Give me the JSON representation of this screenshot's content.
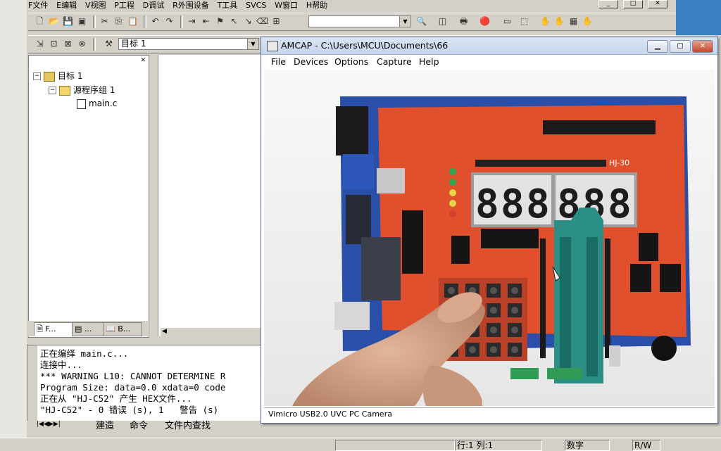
{
  "keil": {
    "menu": [
      "F文件",
      "E编辑",
      "V视图",
      "P工程",
      "D调试",
      "R外围设备",
      "T工具",
      "SVCS",
      "W窗口",
      "H帮助"
    ],
    "target_combo": "目标 1",
    "project": {
      "root": "目标 1",
      "group": "源程序组 1",
      "file": "main.c"
    },
    "project_tabs": [
      "F...",
      "...",
      "B..."
    ],
    "output_lines": [
      "正在编绎 main.c...",
      "连接中...",
      "*** WARNING L10: CANNOT DETERMINE R",
      "Program Size: data=0.0 xdata=0 code",
      "正在从 \"HJ-C52\" 产生 HEX文件...",
      "\"HJ-C52\" - 0 错误 (s), 1   警告 (s)"
    ],
    "output_tabs": [
      "建造",
      "命令",
      "文件内查找"
    ],
    "status": {
      "position": "行:1 列:1",
      "mode": "数字",
      "rw": "R/W"
    }
  },
  "amcap": {
    "title": "AMCAP - C:\\Users\\MCU\\Documents\\66",
    "menu": [
      "File",
      "Devices",
      "Options",
      "Capture",
      "Help"
    ],
    "status": "Vimicro USB2.0 UVC PC Camera",
    "board": {
      "label_top": "HJ-30",
      "display_digits": [
        "8.",
        "8.",
        "8.",
        "8.",
        "8.",
        "8."
      ],
      "key_rows": 4,
      "key_cols": 4
    }
  },
  "icons": [
    "new-file-icon",
    "open-folder-icon",
    "save-icon",
    "save-all-icon",
    "cut-icon",
    "copy-icon",
    "paste-icon",
    "undo-icon",
    "redo-icon",
    "find-icon",
    "print-icon",
    "debug-icon",
    "build-icon",
    "rebuild-icon",
    "translate-icon",
    "stop-build-icon",
    "options-icon"
  ]
}
